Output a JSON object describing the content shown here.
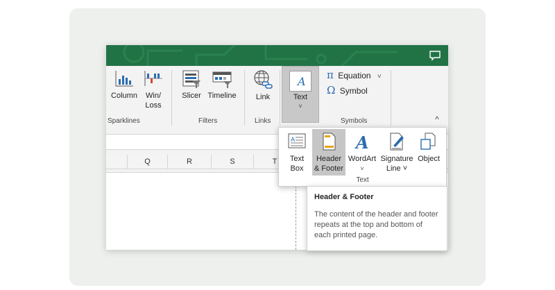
{
  "ribbon": {
    "sparklines": {
      "group_label": "Sparklines",
      "column_label": "Column",
      "winloss_label_1": "Win/",
      "winloss_label_2": "Loss"
    },
    "filters": {
      "group_label": "Filters",
      "slicer_label": "Slicer",
      "timeline_label": "Timeline"
    },
    "links": {
      "group_label": "Links",
      "link_label": "Link"
    },
    "text": {
      "button_label": "Text",
      "chevron": "˅"
    },
    "symbols": {
      "group_label": "Symbols",
      "equation_label": "Equation",
      "equation_icon": "π",
      "symbol_label": "Symbol",
      "symbol_icon": "Ω",
      "chevron": "˅"
    },
    "collapse_icon": "^"
  },
  "columns": [
    "Q",
    "R",
    "S",
    "T"
  ],
  "text_dropdown": {
    "group_label": "Text",
    "items": [
      {
        "line1": "Text",
        "line2": "Box",
        "icon": "text-box-icon"
      },
      {
        "line1": "Header",
        "line2": "& Footer",
        "icon": "header-footer-icon",
        "selected": true
      },
      {
        "line1": "WordArt",
        "line2": "˅",
        "icon": "wordart-icon"
      },
      {
        "line1": "Signature",
        "line2": "Line ˅",
        "icon": "signature-line-icon"
      },
      {
        "line1": "Object",
        "line2": "",
        "icon": "object-icon"
      }
    ]
  },
  "tooltip": {
    "title": "Header & Footer",
    "description": "The content of the header and footer repeats at the top and bottom of each printed page."
  },
  "colors": {
    "titlebar": "#217346",
    "ribbon_bg": "#f3f3f3",
    "selected_bg": "#c6c6c6",
    "accent_blue": "#2b6cb0"
  }
}
